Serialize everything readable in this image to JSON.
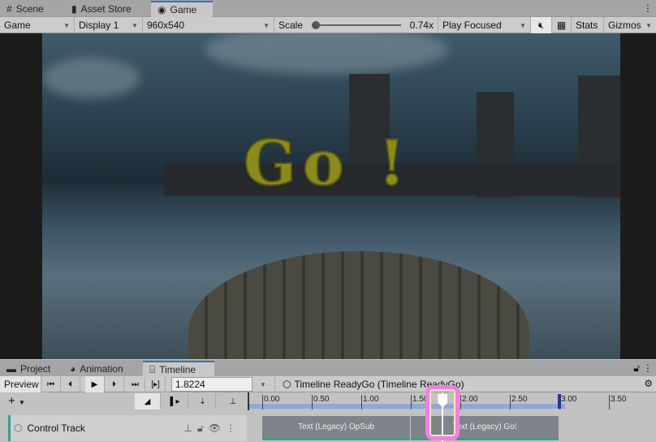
{
  "top_tabs": [
    {
      "label": "Scene",
      "icon": "grid-icon"
    },
    {
      "label": "Asset Store",
      "icon": "bag-icon"
    },
    {
      "label": "Game",
      "icon": "gamepad-icon",
      "active": true
    }
  ],
  "game_toolbar": {
    "view": "Game",
    "display": "Display 1",
    "resolution": "960x540",
    "scale_label": "Scale",
    "scale_value": "0.74x",
    "scale_fraction": 0.0,
    "play_mode": "Play Focused",
    "stats": "Stats",
    "gizmos": "Gizmos"
  },
  "game_view": {
    "overlay_text": "Go !"
  },
  "bottom_tabs": [
    {
      "label": "Project",
      "icon": "folder-icon"
    },
    {
      "label": "Animation",
      "icon": "clock-icon"
    },
    {
      "label": "Timeline",
      "icon": "film-icon",
      "active": true
    }
  ],
  "timeline": {
    "preview": "Preview",
    "time": "1.8224",
    "breadcrumb": "Timeline ReadyGo (Timeline ReadyGo)",
    "ruler_ticks": [
      "0.00",
      "0.50",
      "1.00",
      "1.50",
      "2.00",
      "2.50",
      "3.00",
      "3.50"
    ],
    "playhead_seconds": 1.8224,
    "end_seconds": 3.0,
    "tracks": [
      {
        "name": "Control Track",
        "clips": [
          {
            "label": "Text (Legacy) OpSub",
            "start": 0,
            "end": 1.5
          },
          {
            "label": "Text (Legacy) Go!",
            "start": 1.5,
            "end": 3.0
          }
        ]
      }
    ]
  }
}
